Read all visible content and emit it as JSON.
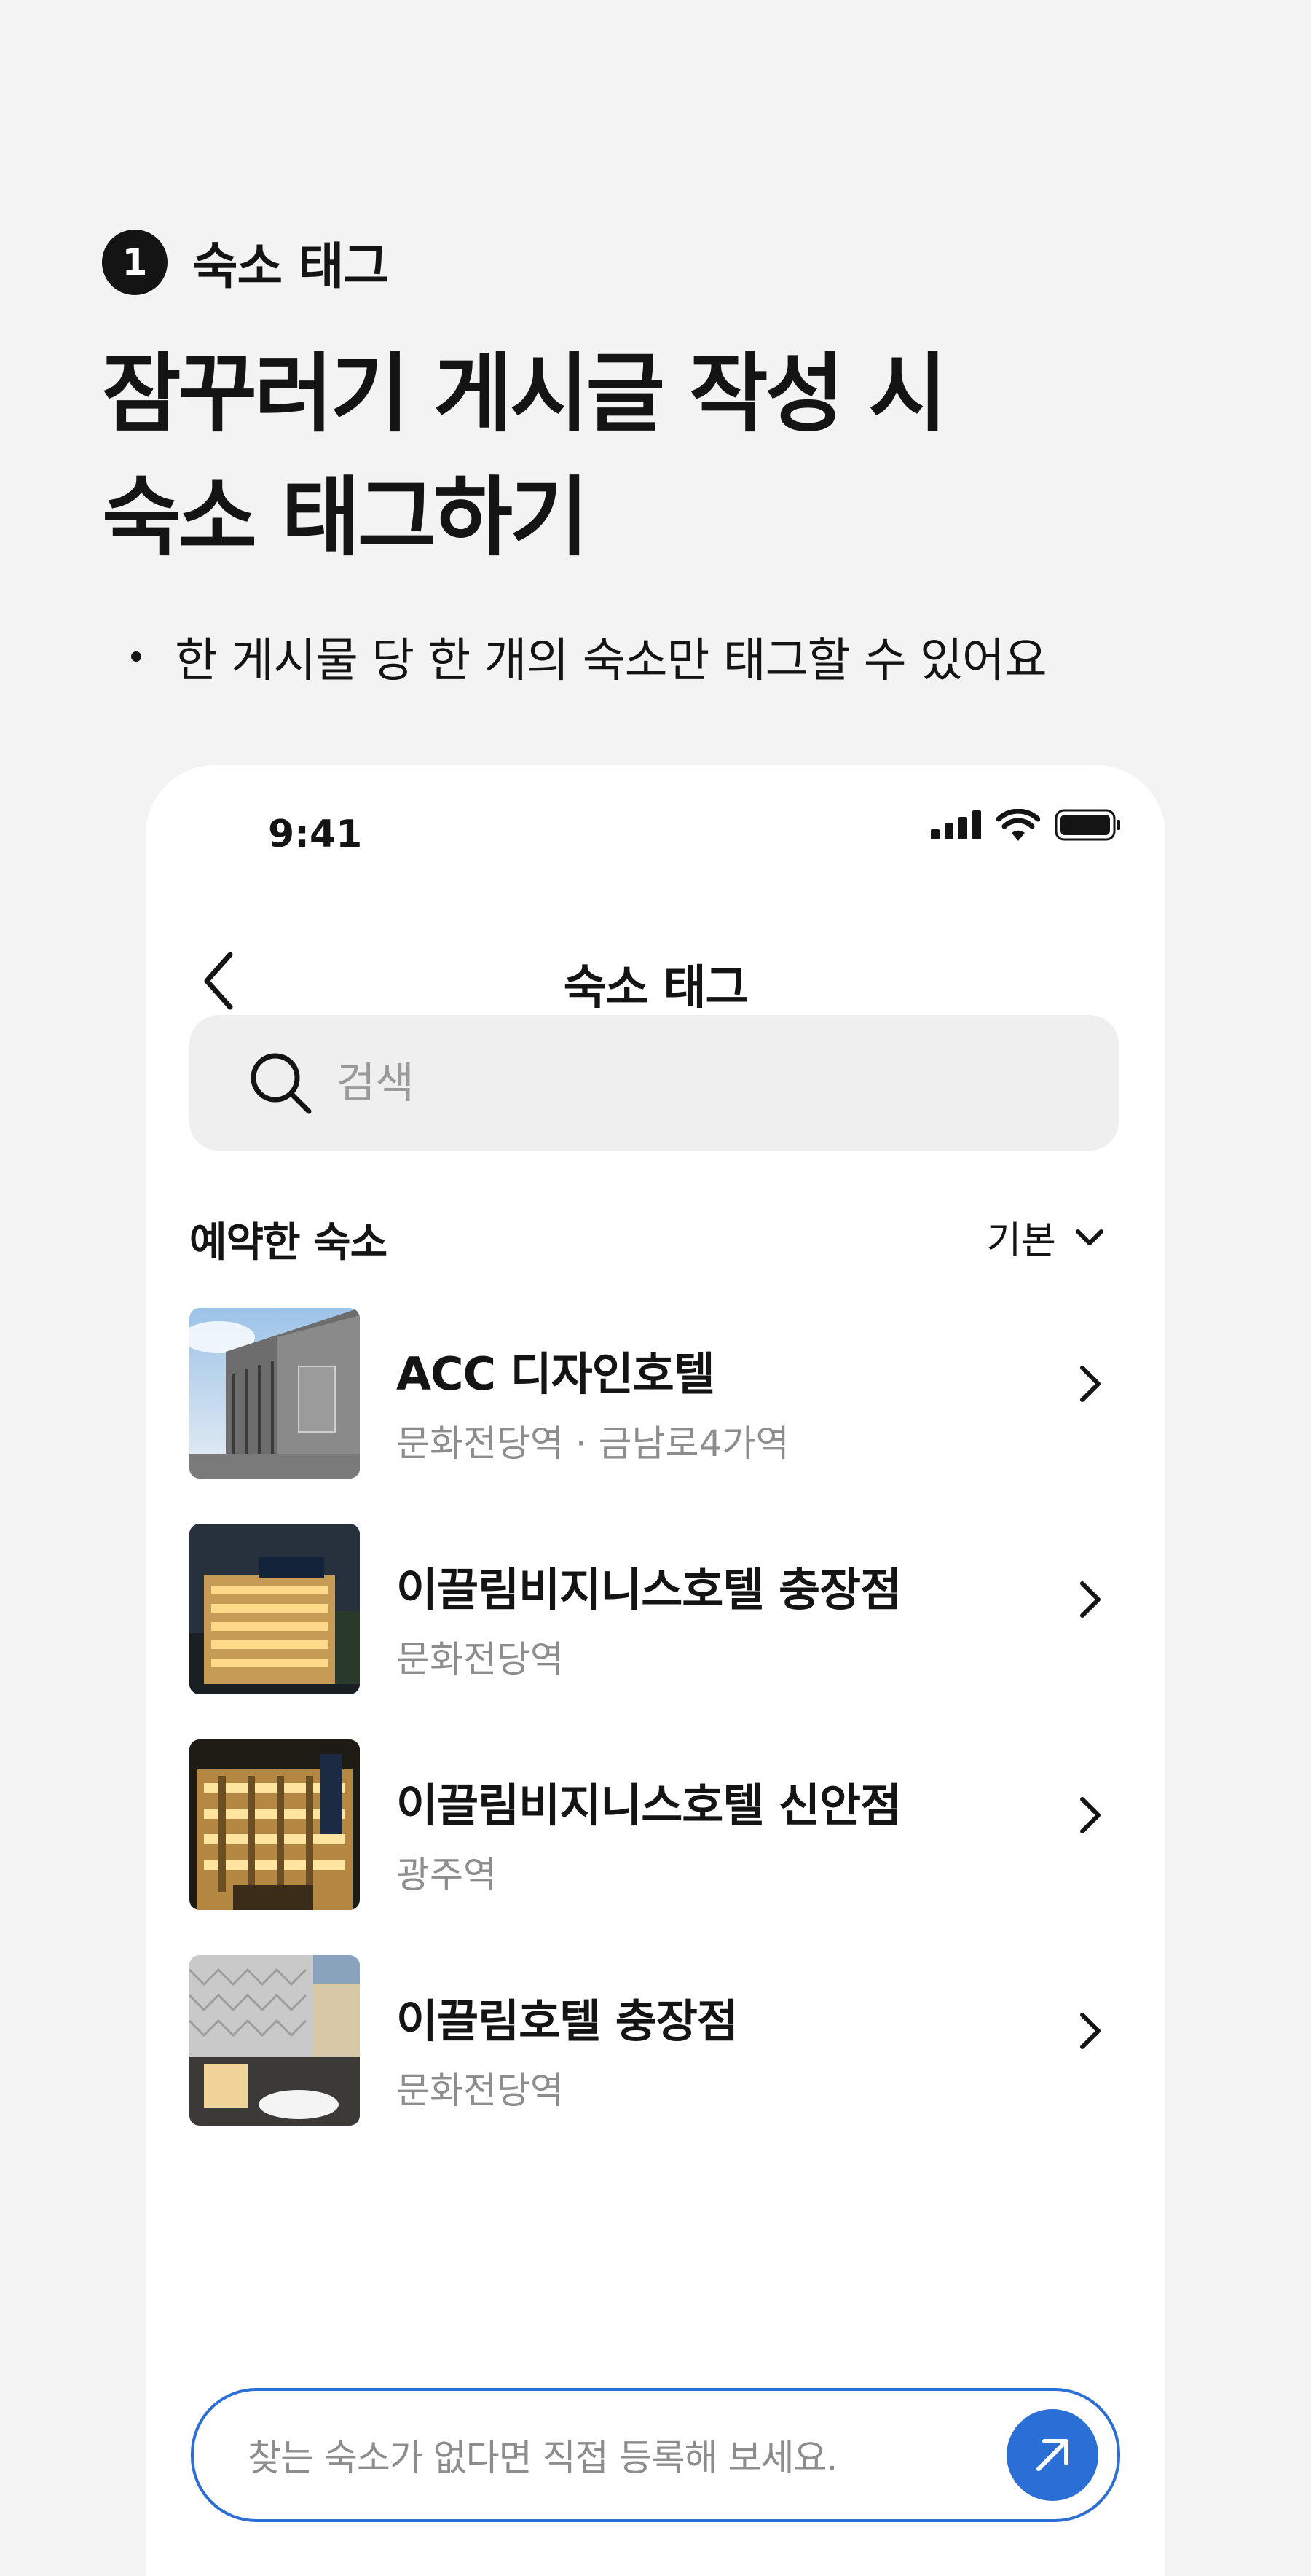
{
  "step": {
    "number": "1",
    "label": "숙소 태그"
  },
  "headline": {
    "line1": "잠꾸러기 게시글 작성 시",
    "line2": "숙소 태그하기"
  },
  "bullet": "한 게시물 당 한 개의 숙소만 태그할 수 있어요",
  "phone": {
    "status_time": "9:41",
    "nav_title": "숙소 태그",
    "search_placeholder": "검색",
    "section_title": "예약한 숙소",
    "sort_label": "기본",
    "items": [
      {
        "name": "ACC 디자인호텔",
        "sub": "문화전당역 · 금남로4가역"
      },
      {
        "name": "이끌림비지니스호텔 충장점",
        "sub": "문화전당역"
      },
      {
        "name": "이끌림비지니스호텔 신안점",
        "sub": "광주역"
      },
      {
        "name": "이끌림호텔 충장점",
        "sub": "문화전당역"
      }
    ],
    "footer_placeholder": "찾는 숙소가 없다면 직접 등록해 보세요."
  },
  "colors": {
    "accent": "#2b6fd6",
    "text": "#141414",
    "muted": "#8d8d8d",
    "background": "#f3f3f3"
  }
}
